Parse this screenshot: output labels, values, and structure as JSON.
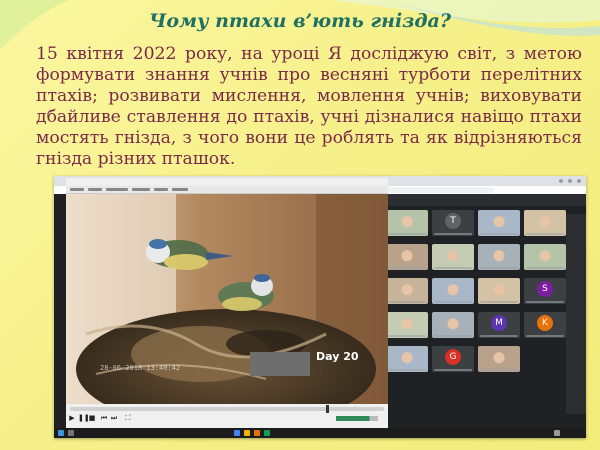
{
  "slide": {
    "title": "Чому птахи в’ють гнізда?",
    "body": "15 квітня 2022 року, на уроці Я досліджую світ, з метою формувати знання учнів про весняні турботи перелітних птахів; розвивати мислення, мовлення учнів; виховувати дбайливе ставлення до птахів, учні дізналися навіщо птахи мостять гнізда, з чого вони це роблять та як відрізняються гнізда різних пташок.",
    "colors": {
      "title": "#1f6f62",
      "body": "#7b2a49",
      "background": "#f6f08a"
    }
  },
  "screenshot": {
    "video_overlay": "Day 20",
    "video_timestamp": "28-06-2018 13:40:42",
    "participants": [
      {
        "initial": "",
        "camera": true
      },
      {
        "initial": "T",
        "camera": false,
        "color": "#5f6368"
      },
      {
        "initial": "",
        "camera": true
      },
      {
        "initial": "",
        "camera": true
      },
      {
        "initial": "",
        "camera": true
      },
      {
        "initial": "",
        "camera": true
      },
      {
        "initial": "",
        "camera": true
      },
      {
        "initial": "",
        "camera": true
      },
      {
        "initial": "",
        "camera": true
      },
      {
        "initial": "",
        "camera": true
      },
      {
        "initial": "",
        "camera": true
      },
      {
        "initial": "S",
        "camera": false,
        "color": "#7b1fa2"
      },
      {
        "initial": "",
        "camera": true
      },
      {
        "initial": "",
        "camera": true
      },
      {
        "initial": "M",
        "camera": false,
        "color": "#5e35b1"
      },
      {
        "initial": "K",
        "camera": false,
        "color": "#e8710a"
      },
      {
        "initial": "",
        "camera": true
      },
      {
        "initial": "G",
        "camera": false,
        "color": "#d93025"
      },
      {
        "initial": "",
        "camera": true
      }
    ]
  }
}
